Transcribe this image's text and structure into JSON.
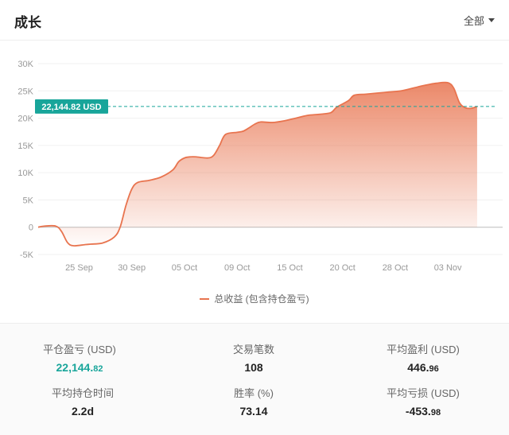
{
  "header": {
    "title": "成长",
    "filter": "全部"
  },
  "legend": {
    "label": "总收益 (包含持仓盈亏)"
  },
  "marker": {
    "label": "22,144.82 USD",
    "value": 22144.82
  },
  "colors": {
    "line": "#e8744f",
    "marker_bg": "#18a59a",
    "accent_teal": "#18a59a"
  },
  "chart_data": {
    "type": "area",
    "ylim": [
      -5000,
      30000
    ],
    "yticks": [
      {
        "v": 30000,
        "l": "30K"
      },
      {
        "v": 25000,
        "l": "25K"
      },
      {
        "v": 20000,
        "l": "20K"
      },
      {
        "v": 15000,
        "l": "15K"
      },
      {
        "v": 10000,
        "l": "10K"
      },
      {
        "v": 5000,
        "l": "5K"
      },
      {
        "v": 0,
        "l": "0"
      },
      {
        "v": -5000,
        "l": "-5K"
      }
    ],
    "xticks": [
      {
        "x": 7,
        "l": "25 Sep"
      },
      {
        "x": 16,
        "l": "30 Sep"
      },
      {
        "x": 25,
        "l": "05 Oct"
      },
      {
        "x": 34,
        "l": "09 Oct"
      },
      {
        "x": 43,
        "l": "15 Oct"
      },
      {
        "x": 52,
        "l": "20 Oct"
      },
      {
        "x": 61,
        "l": "28 Oct"
      },
      {
        "x": 70,
        "l": "03 Nov"
      }
    ],
    "xlim": [
      0,
      78
    ],
    "values": [
      [
        0,
        0
      ],
      [
        1,
        200
      ],
      [
        3,
        200
      ],
      [
        4,
        -800
      ],
      [
        5,
        -2800
      ],
      [
        6,
        -3400
      ],
      [
        8,
        -3200
      ],
      [
        9,
        -3100
      ],
      [
        11,
        -2900
      ],
      [
        13,
        -1800
      ],
      [
        14,
        0
      ],
      [
        15,
        4000
      ],
      [
        16,
        7000
      ],
      [
        17,
        8200
      ],
      [
        19,
        8600
      ],
      [
        21,
        9200
      ],
      [
        23,
        10500
      ],
      [
        24,
        12000
      ],
      [
        25,
        12700
      ],
      [
        26,
        12900
      ],
      [
        27,
        12900
      ],
      [
        29,
        12700
      ],
      [
        30,
        13200
      ],
      [
        31,
        15000
      ],
      [
        32,
        17000
      ],
      [
        34,
        17400
      ],
      [
        35,
        17600
      ],
      [
        36,
        18200
      ],
      [
        37,
        18900
      ],
      [
        38,
        19300
      ],
      [
        40,
        19200
      ],
      [
        42,
        19500
      ],
      [
        44,
        20000
      ],
      [
        46,
        20500
      ],
      [
        48,
        20700
      ],
      [
        50,
        21000
      ],
      [
        51,
        22000
      ],
      [
        53,
        23200
      ],
      [
        54,
        24200
      ],
      [
        56,
        24400
      ],
      [
        58,
        24600
      ],
      [
        60,
        24800
      ],
      [
        62,
        25000
      ],
      [
        64,
        25500
      ],
      [
        66,
        26000
      ],
      [
        68,
        26400
      ],
      [
        70,
        26500
      ],
      [
        71,
        25500
      ],
      [
        72,
        22800
      ],
      [
        73,
        21900
      ],
      [
        74,
        21800
      ],
      [
        75,
        22144.82
      ]
    ]
  },
  "stats": [
    {
      "label": "平仓盈亏 (USD)",
      "int": "22,144.",
      "dec": "82",
      "teal": true
    },
    {
      "label": "交易笔数",
      "int": "108",
      "dec": "",
      "teal": false
    },
    {
      "label": "平均盈利 (USD)",
      "int": "446.",
      "dec": "96",
      "teal": false
    },
    {
      "label": "平均持仓时间",
      "int": "2.2d",
      "dec": "",
      "teal": false
    },
    {
      "label": "胜率 (%)",
      "int": "73.14",
      "dec": "",
      "teal": false
    },
    {
      "label": "平均亏损 (USD)",
      "int": "-453.",
      "dec": "98",
      "teal": false
    }
  ]
}
